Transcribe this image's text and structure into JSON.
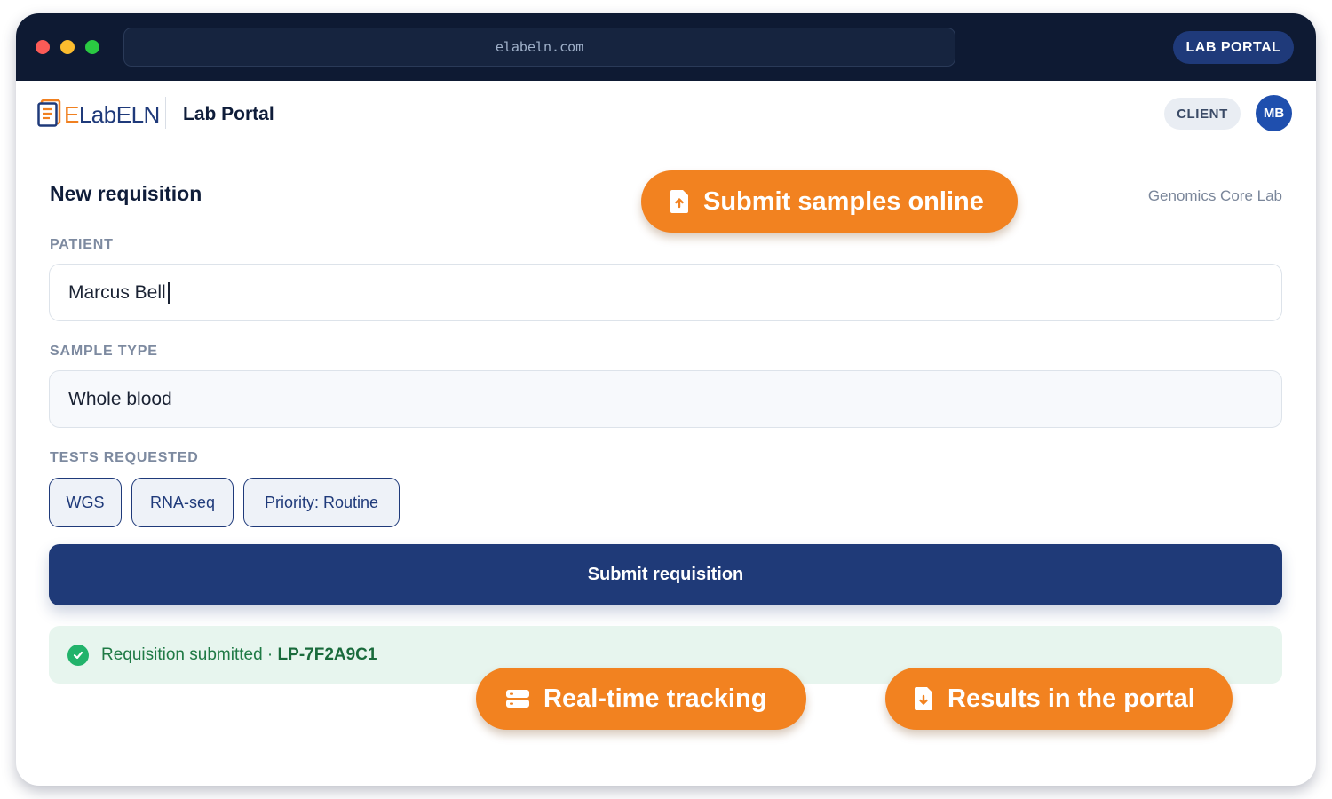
{
  "browser": {
    "url": "elabeln.com",
    "badge": "LAB PORTAL"
  },
  "header": {
    "logo_prefix": "E",
    "logo_rest": "LabELN",
    "app_title": "Lab Portal",
    "role": "CLIENT",
    "avatar_initials": "MB"
  },
  "form": {
    "title": "New requisition",
    "lab_name": "Genomics Core Lab",
    "patient_label": "PATIENT",
    "patient_value": "Marcus Bell",
    "sample_type_label": "SAMPLE TYPE",
    "sample_type_value": "Whole blood",
    "tests_label": "TESTS REQUESTED",
    "tests": [
      "WGS",
      "RNA-seq",
      "Priority: Routine"
    ],
    "submit_label": "Submit requisition",
    "success_message": "Requisition submitted · ",
    "requisition_id": "LP-7F2A9C1"
  },
  "callouts": {
    "submit": "Submit samples online",
    "tracking": "Real-time tracking",
    "results": "Results in the portal"
  },
  "colors": {
    "brand_navy": "#1f3a78",
    "accent_orange": "#f28220",
    "success_green": "#22b36b",
    "chrome_dark": "#0e1a33"
  },
  "icons": {
    "window_controls": [
      "close-dot",
      "minimize-dot",
      "maximize-dot"
    ],
    "logo": "notebook-icon",
    "success": "check-circle-icon",
    "callout_submit": "file-upload-icon",
    "callout_tracking": "server-icon",
    "callout_results": "file-download-icon"
  }
}
